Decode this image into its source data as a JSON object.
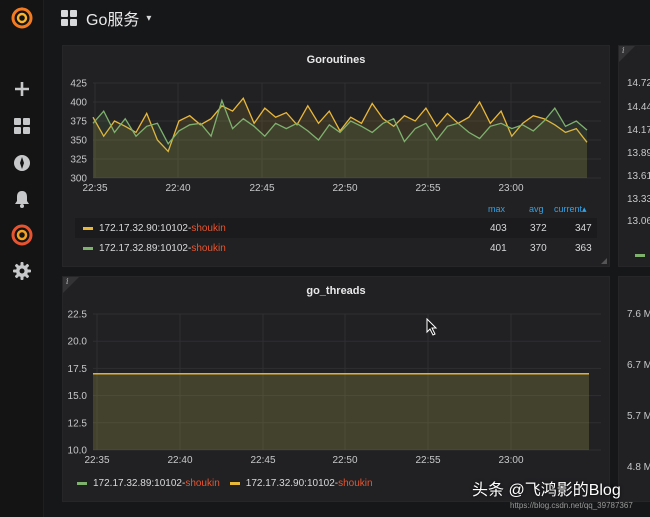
{
  "topbar": {
    "dashboard_title": "Go服务",
    "caret": "▾"
  },
  "sidebar": {
    "items": [
      {
        "name": "grafana-logo"
      },
      {
        "name": "create"
      },
      {
        "name": "dashboards"
      },
      {
        "name": "explore"
      },
      {
        "name": "alerting"
      },
      {
        "name": "plugins"
      },
      {
        "name": "configuration"
      }
    ]
  },
  "panels": {
    "goroutines": {
      "title": "Goroutines",
      "corner": "i",
      "legend": {
        "headers": [
          "max",
          "avg",
          "current▴"
        ],
        "rows": [
          {
            "label": "172.17.32.90:10102-",
            "obscured": "shoukin",
            "color": "#eab839",
            "max": "403",
            "avg": "372",
            "current": "347"
          },
          {
            "label": "172.17.32.89:10102-",
            "obscured": "shoukin",
            "color": "#7eb26d",
            "max": "401",
            "avg": "370",
            "current": "363"
          }
        ]
      }
    },
    "go_threads": {
      "title": "go_threads",
      "corner": "i",
      "legend": [
        {
          "label": "172.17.32.89:10102-",
          "obscured": "shoukin",
          "color": "#7eb26d"
        },
        {
          "label": "172.17.32.90:10102-",
          "obscured": "shoukin",
          "color": "#eab839"
        }
      ]
    },
    "right_top": {
      "corner": "i",
      "ticks": [
        "14.72",
        "14.44",
        "14.17",
        "13.89",
        "13.61",
        "13.33",
        "13.06"
      ]
    },
    "right_bottom": {
      "ticks": [
        "7.6 M",
        "6.7 M",
        "5.7 M",
        "4.8 M"
      ]
    }
  },
  "watermark": {
    "text": "头条 @飞鸿影的Blog",
    "url_fragment": "https://blog.csdn.net/qq_39787367"
  },
  "chart_data": [
    {
      "type": "line",
      "title": "Goroutines",
      "x_ticks": [
        "22:35",
        "22:40",
        "22:45",
        "22:50",
        "22:55",
        "23:00"
      ],
      "y_ticks": [
        "300",
        "325",
        "350",
        "375",
        "400",
        "425"
      ],
      "ylim": [
        300,
        425
      ],
      "x_start_label": "22:35",
      "x_step_seconds": 60,
      "series": [
        {
          "name": "172.17.32.90:10102-",
          "color": "#eab839",
          "values": [
            380,
            355,
            375,
            368,
            360,
            385,
            350,
            335,
            375,
            382,
            370,
            378,
            395,
            388,
            405,
            372,
            392,
            380,
            386,
            370,
            395,
            372,
            388,
            362,
            380,
            372,
            398,
            378,
            368,
            382,
            375,
            392,
            368,
            385,
            372,
            380,
            400,
            372,
            388,
            355,
            372,
            382,
            378,
            370,
            360,
            365,
            347
          ]
        },
        {
          "name": "172.17.32.89:10102-",
          "color": "#7eb26d",
          "values": [
            372,
            388,
            360,
            378,
            355,
            368,
            372,
            345,
            362,
            370,
            372,
            355,
            402,
            365,
            378,
            368,
            355,
            372,
            365,
            372,
            362,
            350,
            370,
            360,
            375,
            368,
            360,
            372,
            378,
            348,
            365,
            372,
            350,
            368,
            372,
            360,
            352,
            368,
            372,
            365,
            370,
            362,
            375,
            392,
            368,
            375,
            363
          ]
        }
      ]
    },
    {
      "type": "line",
      "title": "go_threads",
      "x_ticks": [
        "22:35",
        "22:40",
        "22:45",
        "22:50",
        "22:55",
        "23:00"
      ],
      "y_ticks": [
        "10.0",
        "12.5",
        "15.0",
        "17.5",
        "20.0",
        "22.5"
      ],
      "ylim": [
        10,
        22.5
      ],
      "series": [
        {
          "name": "172.17.32.89:10102-",
          "color": "#7eb26d",
          "values": [
            17,
            17
          ]
        },
        {
          "name": "172.17.32.90:10102-",
          "color": "#eab839",
          "values": [
            17,
            17
          ]
        }
      ]
    }
  ]
}
